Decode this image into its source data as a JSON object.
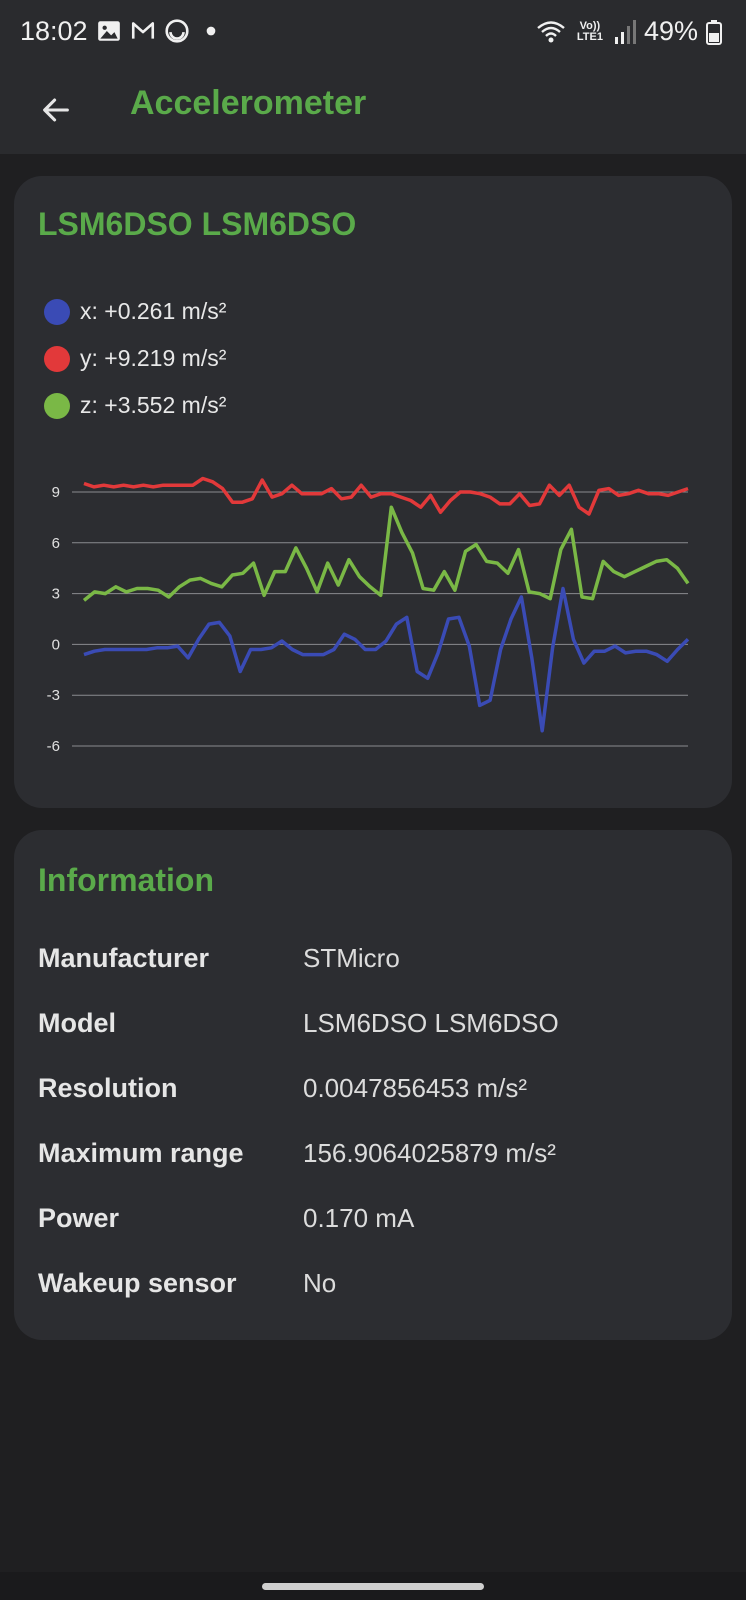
{
  "status_bar": {
    "time": "18:02",
    "battery": "49%",
    "left_icons": [
      "gallery-icon",
      "gmail-icon",
      "sync-icon",
      "dot-icon"
    ],
    "right_icons": [
      "wifi-icon",
      "volte-icon",
      "signal-icon",
      "battery-icon"
    ],
    "volte_label": "Vo)) LTE1"
  },
  "app_bar": {
    "title": "Accelerometer",
    "back_icon": "arrow-left-icon"
  },
  "sensor_card": {
    "title": "LSM6DSO LSM6DSO",
    "legend": [
      {
        "label": "x: +0.261 m/s²",
        "color": "#3a4bb5"
      },
      {
        "label": "y: +9.219 m/s²",
        "color": "#e2393a"
      },
      {
        "label": "z: +3.552 m/s²",
        "color": "#7ab846"
      }
    ]
  },
  "chart_data": {
    "type": "line",
    "ylim": [
      -6,
      9
    ],
    "yticks": [
      "9",
      "6",
      "3",
      "0",
      "-3",
      "-6"
    ],
    "grid": true,
    "series": [
      {
        "name": "y",
        "color": "#e2393a",
        "values": [
          9.5,
          9.3,
          9.4,
          9.3,
          9.4,
          9.3,
          9.4,
          9.3,
          9.4,
          9.4,
          9.4,
          9.4,
          9.8,
          9.6,
          9.2,
          8.4,
          8.4,
          8.6,
          9.7,
          8.7,
          8.9,
          9.4,
          8.9,
          8.9,
          8.9,
          9.2,
          8.6,
          8.7,
          9.4,
          8.7,
          8.9,
          8.9,
          8.7,
          8.5,
          8.1,
          8.8,
          7.8,
          8.5,
          9.0,
          9.0,
          8.9,
          8.7,
          8.3,
          8.3,
          8.9,
          8.2,
          8.3,
          9.4,
          8.8,
          9.4,
          8.1,
          7.7,
          9.1,
          9.2,
          8.8,
          8.9,
          9.1,
          8.9,
          8.9,
          8.8,
          9.0,
          9.2
        ]
      },
      {
        "name": "z",
        "color": "#7ab846",
        "values": [
          2.6,
          3.1,
          3.0,
          3.4,
          3.1,
          3.3,
          3.3,
          3.2,
          2.8,
          3.4,
          3.8,
          3.9,
          3.6,
          3.4,
          4.1,
          4.2,
          4.8,
          2.9,
          4.3,
          4.3,
          5.7,
          4.5,
          3.1,
          4.8,
          3.5,
          5.0,
          4.0,
          3.4,
          2.9,
          8.1,
          6.6,
          5.4,
          3.3,
          3.2,
          4.3,
          3.2,
          5.5,
          5.9,
          4.9,
          4.8,
          4.2,
          5.6,
          3.1,
          3.0,
          2.7,
          5.6,
          6.8,
          2.8,
          2.7,
          4.9,
          4.3,
          4.0,
          4.3,
          4.6,
          4.9,
          5.0,
          4.5,
          3.6
        ]
      },
      {
        "name": "x",
        "color": "#3a4bb5",
        "values": [
          -0.6,
          -0.4,
          -0.3,
          -0.3,
          -0.3,
          -0.3,
          -0.3,
          -0.2,
          -0.2,
          -0.1,
          -0.8,
          0.3,
          1.2,
          1.3,
          0.5,
          -1.6,
          -0.3,
          -0.3,
          -0.2,
          0.2,
          -0.3,
          -0.6,
          -0.6,
          -0.6,
          -0.3,
          0.6,
          0.3,
          -0.3,
          -0.3,
          0.2,
          1.2,
          1.6,
          -1.6,
          -2.0,
          -0.5,
          1.5,
          1.6,
          -0.1,
          -3.6,
          -3.3,
          -0.3,
          1.5,
          2.8,
          -0.8,
          -5.1,
          -0.2,
          3.3,
          0.3,
          -1.1,
          -0.4,
          -0.4,
          -0.1,
          -0.5,
          -0.4,
          -0.4,
          -0.6,
          -1.0,
          -0.3,
          0.3
        ]
      }
    ]
  },
  "info_card": {
    "title": "Information",
    "rows": [
      {
        "label": "Manufacturer",
        "value": "STMicro"
      },
      {
        "label": "Model",
        "value": "LSM6DSO LSM6DSO"
      },
      {
        "label": "Resolution",
        "value": "0.0047856453 m/s²"
      },
      {
        "label": "Maximum range",
        "value": "156.9064025879 m/s²"
      },
      {
        "label": "Power",
        "value": "0.170 mA"
      },
      {
        "label": "Wakeup sensor",
        "value": "No"
      }
    ]
  }
}
